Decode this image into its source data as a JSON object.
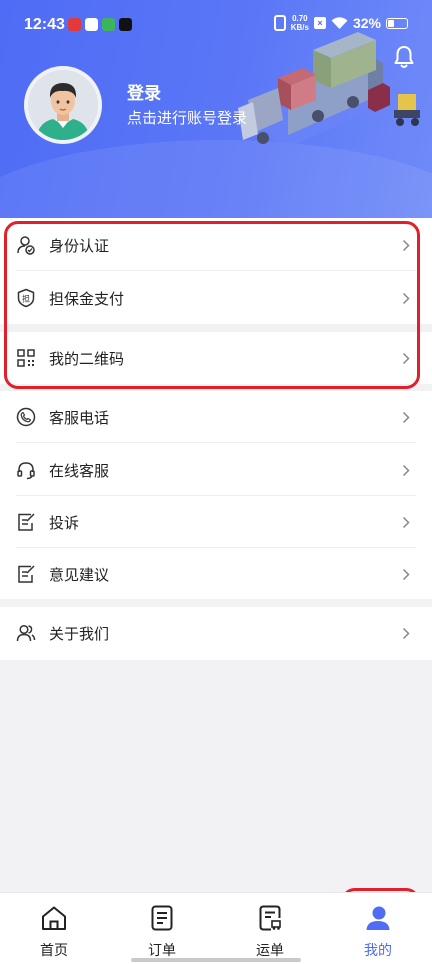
{
  "status": {
    "time": "12:43",
    "net_value": "0.70",
    "net_unit": "KB/s",
    "battery": "32%"
  },
  "profile": {
    "title": "登录",
    "subtitle": "点击进行账号登录"
  },
  "menu": {
    "group1": [
      {
        "label": "身份认证",
        "icon": "user-verify-icon"
      },
      {
        "label": "担保金支付",
        "icon": "guarantee-shield-icon"
      }
    ],
    "group2": [
      {
        "label": "我的二维码",
        "icon": "qrcode-icon"
      }
    ],
    "group3": [
      {
        "label": "客服电话",
        "icon": "phone-icon"
      },
      {
        "label": "在线客服",
        "icon": "headset-icon"
      },
      {
        "label": "投诉",
        "icon": "complaint-edit-icon"
      },
      {
        "label": "意见建议",
        "icon": "feedback-edit-icon"
      }
    ],
    "group4": [
      {
        "label": "关于我们",
        "icon": "people-icon"
      }
    ]
  },
  "tabs": [
    {
      "label": "首页",
      "icon": "home-icon"
    },
    {
      "label": "订单",
      "icon": "order-doc-icon"
    },
    {
      "label": "运单",
      "icon": "waybill-doc-icon"
    },
    {
      "label": "我的",
      "icon": "profile-icon",
      "active": true
    }
  ],
  "colors": {
    "primary": "#4e6cf5",
    "highlight": "#e0202a"
  }
}
